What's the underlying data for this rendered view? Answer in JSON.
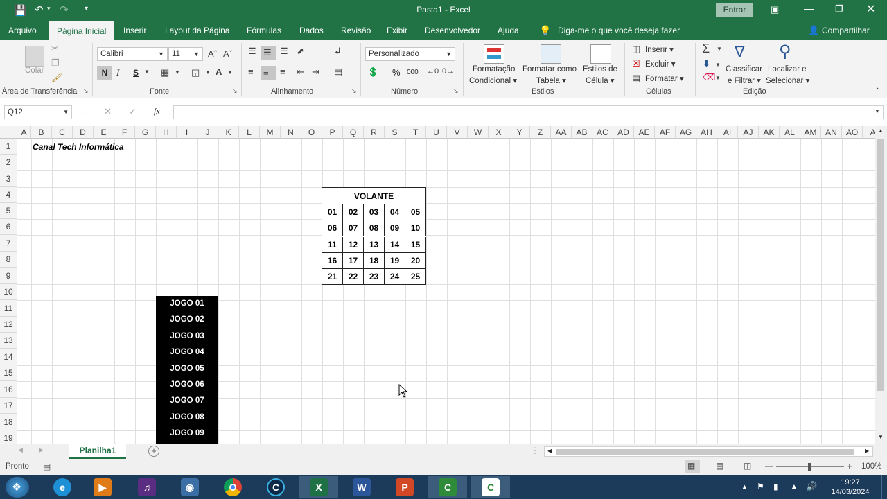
{
  "title": {
    "doc": "Pasta1",
    "sep": "-",
    "app": "Excel",
    "signin": "Entrar"
  },
  "tabs": [
    "Arquivo",
    "Página Inicial",
    "Inserir",
    "Layout da Página",
    "Fórmulas",
    "Dados",
    "Revisão",
    "Exibir",
    "Desenvolvedor",
    "Ajuda"
  ],
  "tellme": "Diga-me o que você deseja fazer",
  "share": "Compartilhar",
  "ribbon": {
    "paste": "Colar",
    "font_name": "Calibri",
    "font_size": "11",
    "bold": "N",
    "italic": "I",
    "underline": "S",
    "number_format": "Personalizado",
    "cond_format_1": "Formatação",
    "cond_format_2": "Condicional",
    "format_table_1": "Formatar como",
    "format_table_2": "Tabela",
    "cell_styles_1": "Estilos de",
    "cell_styles_2": "Célula",
    "insert": "Inserir",
    "delete": "Excluir",
    "format": "Formatar",
    "sort_1": "Classificar",
    "sort_2": "e Filtrar",
    "find_1": "Localizar e",
    "find_2": "Selecionar",
    "percent": "%",
    "thousands": "000"
  },
  "groups": {
    "clipboard": "Área de Transferência",
    "font": "Fonte",
    "alignment": "Alinhamento",
    "number": "Número",
    "styles": "Estilos",
    "cells": "Células",
    "editing": "Edição"
  },
  "formula_bar": {
    "namebox": "Q12",
    "fx": "fx",
    "value": ""
  },
  "columns": [
    "A",
    "B",
    "C",
    "D",
    "E",
    "F",
    "G",
    "H",
    "I",
    "J",
    "K",
    "L",
    "M",
    "N",
    "O",
    "P",
    "Q",
    "R",
    "S",
    "T",
    "U",
    "V",
    "W",
    "X",
    "Y",
    "Z",
    "AA",
    "AB",
    "AC",
    "AD",
    "AE",
    "AF",
    "AG",
    "AH",
    "AI",
    "AJ",
    "AK",
    "AL",
    "AM",
    "AN",
    "AO",
    "A"
  ],
  "rows": [
    "1",
    "2",
    "3",
    "4",
    "5",
    "6",
    "7",
    "8",
    "9",
    "10",
    "11",
    "12",
    "13",
    "14",
    "15",
    "16",
    "17",
    "18",
    "19"
  ],
  "cells": {
    "b1": "Canal Tech Informática",
    "volante_title": "VOLANTE",
    "volante_numbers": [
      [
        "01",
        "02",
        "03",
        "04",
        "05"
      ],
      [
        "06",
        "07",
        "08",
        "09",
        "10"
      ],
      [
        "11",
        "12",
        "13",
        "14",
        "15"
      ],
      [
        "16",
        "17",
        "18",
        "19",
        "20"
      ],
      [
        "21",
        "22",
        "23",
        "24",
        "25"
      ]
    ],
    "jogos": [
      "JOGO 01",
      "JOGO 02",
      "JOGO 03",
      "JOGO 04",
      "JOGO 05",
      "JOGO 06",
      "JOGO 07",
      "JOGO 08",
      "JOGO 09"
    ]
  },
  "sheet_tab": "Planilha1",
  "status": {
    "ready": "Pronto",
    "zoom": "100%",
    "minus": "—",
    "plus": "+"
  },
  "taskbar": {
    "time": "19:27",
    "date": "14/03/2024"
  },
  "colors": {
    "excel_green": "#217346",
    "taskbar": "#1c3a5a"
  }
}
